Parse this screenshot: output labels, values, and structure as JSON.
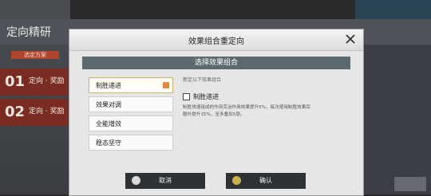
{
  "background": {
    "title": "定向精研",
    "subtab": "选定方案",
    "cards": [
      {
        "num": "01",
        "label": "定向 · 奖励"
      },
      {
        "num": "02",
        "label": "定向 · 奖励"
      }
    ]
  },
  "modal": {
    "title": "效果组合重定向",
    "section_title": "选择效果组合",
    "options": [
      {
        "label": "制胜递进",
        "selected": true
      },
      {
        "label": "效果对调",
        "selected": false
      },
      {
        "label": "全能增效",
        "selected": false
      },
      {
        "label": "稳态坚守",
        "selected": false
      }
    ],
    "detail": {
      "hint": "新定以下效果组合",
      "effect_name": "制胜递进",
      "desc_lines": [
        "制胜快速组成的作用克治作用效果提升5%，每次使用制胜效果后",
        "额外提升15%，至多叠加5层。"
      ]
    },
    "buttons": {
      "cancel": "取消",
      "confirm": "确认"
    }
  },
  "colors": {
    "accent_orange": "#e2883a",
    "bar": "#5a6a70",
    "button_dark": "#2f3235"
  }
}
